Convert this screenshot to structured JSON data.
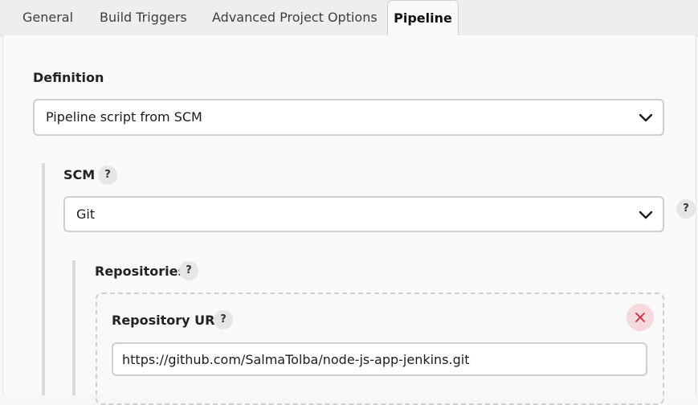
{
  "tabs": [
    {
      "label": "General"
    },
    {
      "label": "Build Triggers"
    },
    {
      "label": "Advanced Project Options"
    },
    {
      "label": "Pipeline",
      "active": true
    }
  ],
  "definition": {
    "label": "Definition",
    "selected": "Pipeline script from SCM"
  },
  "scm": {
    "label": "SCM",
    "help": "?",
    "selected": "Git",
    "side_help": "?"
  },
  "repositories": {
    "label": "Repositories",
    "help": "?",
    "repository_url": {
      "label": "Repository URL",
      "help": "?",
      "value": "https://github.com/SalmaTolba/node-js-app-jenkins.git"
    }
  },
  "icons": {
    "chevron": "chevron-down-icon",
    "help": "help-icon",
    "close": "close-icon"
  },
  "colors": {
    "close_icon": "#d2293a",
    "close_bg": "#f6d9dc"
  }
}
